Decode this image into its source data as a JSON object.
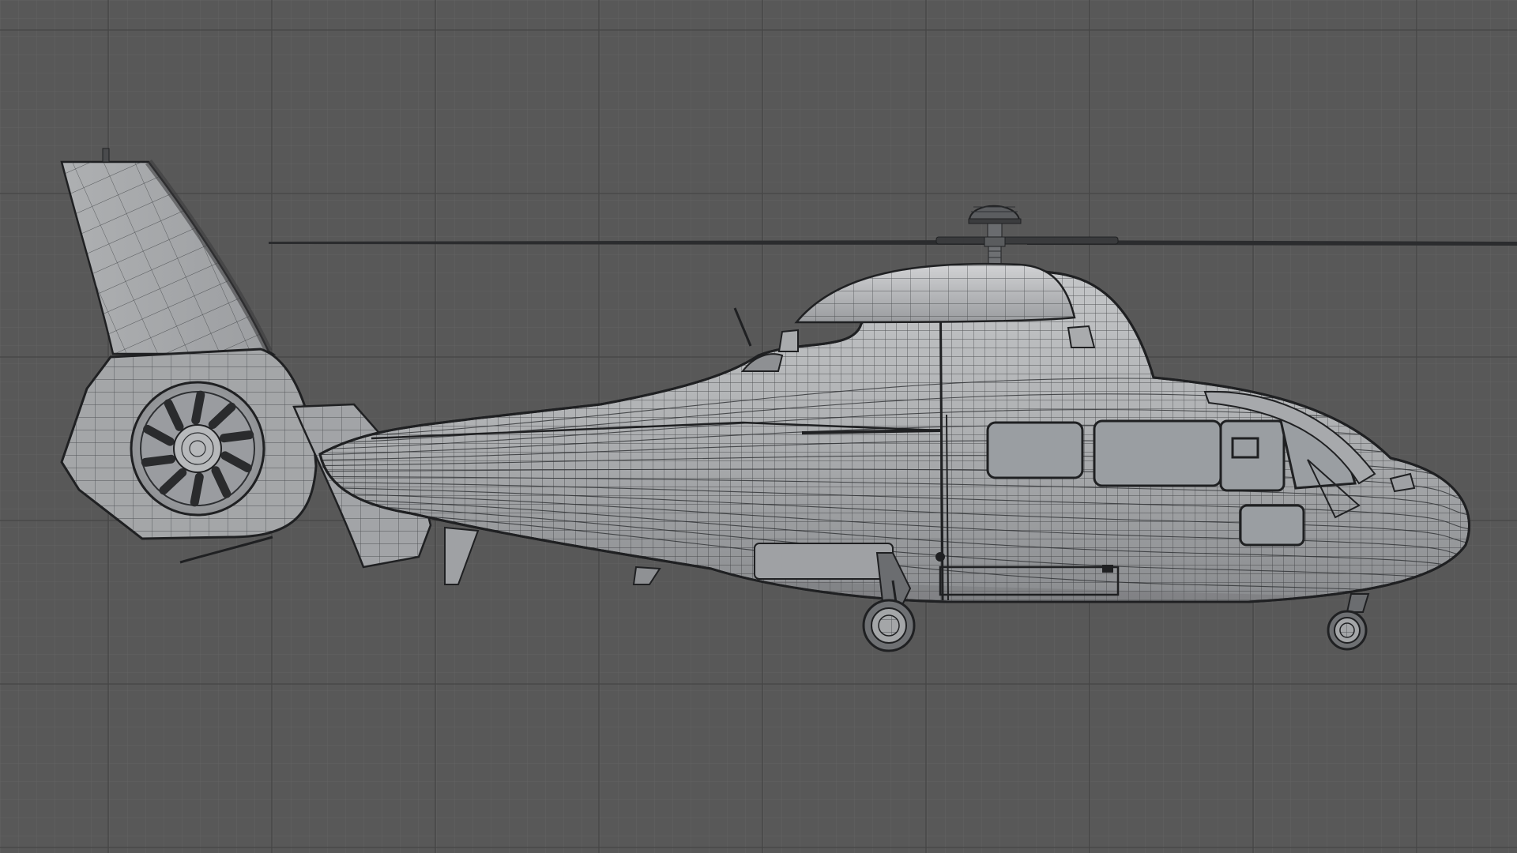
{
  "viewport": {
    "background": "#585858",
    "grid_minor_color": "#626262",
    "grid_major_color": "#454545",
    "shading": "wireframe-on-shaded",
    "view": "side"
  },
  "model": {
    "body_color": "#a7a9ab",
    "body_highlight": "#c9cacc",
    "body_shadow": "#7d7f82",
    "wire_color": "#2e3033",
    "outline_color": "#1f2022",
    "glass_color": "#8f9397",
    "components": [
      "main-rotor",
      "rotor-hub",
      "engine-cowling",
      "fuselage",
      "cockpit-windows",
      "cabin-windows",
      "cabin-door",
      "tail-boom",
      "vertical-fin",
      "fenestron",
      "horizontal-stabilizer",
      "main-landing-gear",
      "nose-landing-gear",
      "antenna"
    ]
  }
}
